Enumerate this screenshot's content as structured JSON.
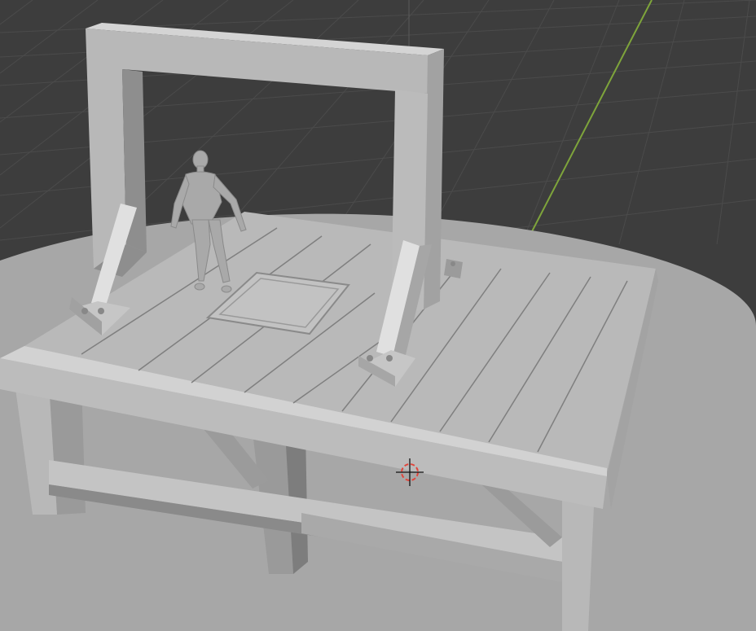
{
  "app": {
    "name": "3D viewport",
    "mode": "solid-shading"
  },
  "viewport": {
    "background_color": "#3d3d3d",
    "grid_line_color": "#4b4b4b",
    "y_axis_color": "#7ea43b",
    "ground_color": "#a7a7a7"
  },
  "scene": {
    "objects": [
      {
        "name": "ground-plane",
        "type": "mesh"
      },
      {
        "name": "gallows-frame",
        "type": "mesh"
      },
      {
        "name": "platform-deck",
        "type": "mesh"
      },
      {
        "name": "trapdoor",
        "type": "mesh"
      },
      {
        "name": "human-figure",
        "type": "mesh"
      },
      {
        "name": "support-legs",
        "type": "mesh"
      }
    ],
    "cursor": {
      "icon": "3d-cursor-icon"
    }
  },
  "colors": {
    "mesh_light": "#c9c9c9",
    "mesh_mid": "#b3b3b3",
    "mesh_dark": "#8e8e8e",
    "mesh_shadow": "#6f6f6f",
    "cursor_red": "#e0453b"
  }
}
